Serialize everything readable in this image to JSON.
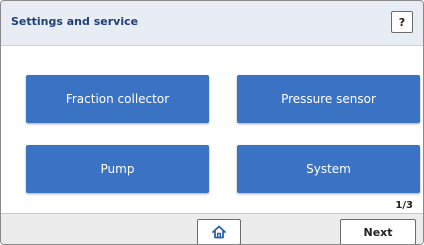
{
  "header": {
    "title": "Settings and service",
    "help_label": "?"
  },
  "menu": {
    "items": [
      {
        "label": "Fraction collector"
      },
      {
        "label": "Pressure sensor"
      },
      {
        "label": "Pump"
      },
      {
        "label": "System"
      }
    ]
  },
  "pagination": {
    "indicator": "1/3"
  },
  "footer": {
    "home_icon": "home-icon",
    "next_label": "Next"
  },
  "colors": {
    "accent": "#3a72c4",
    "header_bg": "#e8ecf4",
    "title_text": "#1e3f78"
  }
}
